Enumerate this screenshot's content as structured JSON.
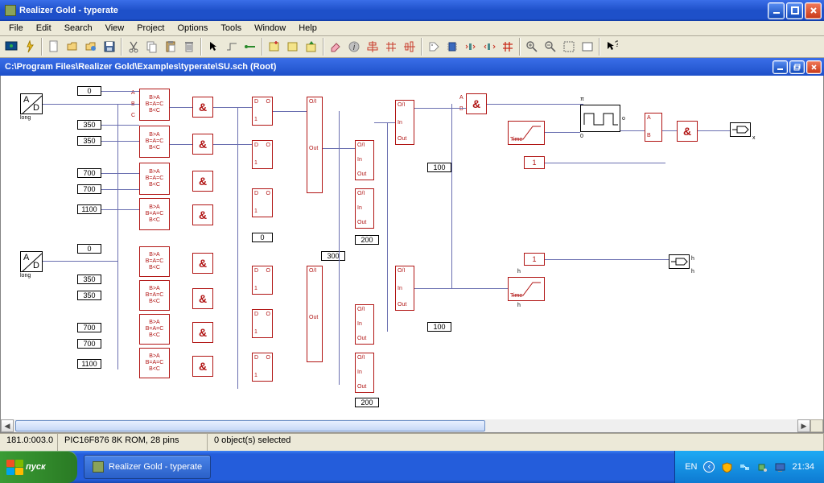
{
  "app": {
    "title": "Realizer Gold - typerate",
    "menus": [
      "File",
      "Edit",
      "Search",
      "View",
      "Project",
      "Options",
      "Tools",
      "Window",
      "Help"
    ]
  },
  "document": {
    "title": "C:\\Program Files\\Realizer Gold\\Examples\\typerate\\SU.sch  (Root)"
  },
  "status": {
    "coord": "181.0:003.0",
    "chip": "PIC16F876 8K ROM, 28 pins",
    "selection": "0 object(s) selected"
  },
  "taskbar": {
    "start": "пуск",
    "app_button": "Realizer Gold - typerate",
    "lang": "EN",
    "clock": "21:34"
  },
  "schematic": {
    "adc_label": "A",
    "adc_sub": "D",
    "adc_long": "long",
    "values": {
      "zero": "0",
      "v350": "350",
      "v700": "700",
      "v1100": "1100",
      "v100": "100",
      "v200": "200",
      "v300": "300"
    },
    "cmp": {
      "line1": "B>A",
      "line2": "B=A=C",
      "line3": "B<C"
    },
    "labels": {
      "A": "A",
      "B": "B",
      "C": "C"
    },
    "gate": "&",
    "mux": {
      "d": "D",
      "o": "O",
      "one": "1"
    },
    "latch": {
      "oi": "O/I",
      "in": "In",
      "out": "Out"
    },
    "timer": {
      "label": "Time"
    },
    "one_block": "1",
    "pulse_pi": "π",
    "pulse_o": "o",
    "pulse_zero": "0",
    "out_h": "h",
    "out_x": "x"
  }
}
